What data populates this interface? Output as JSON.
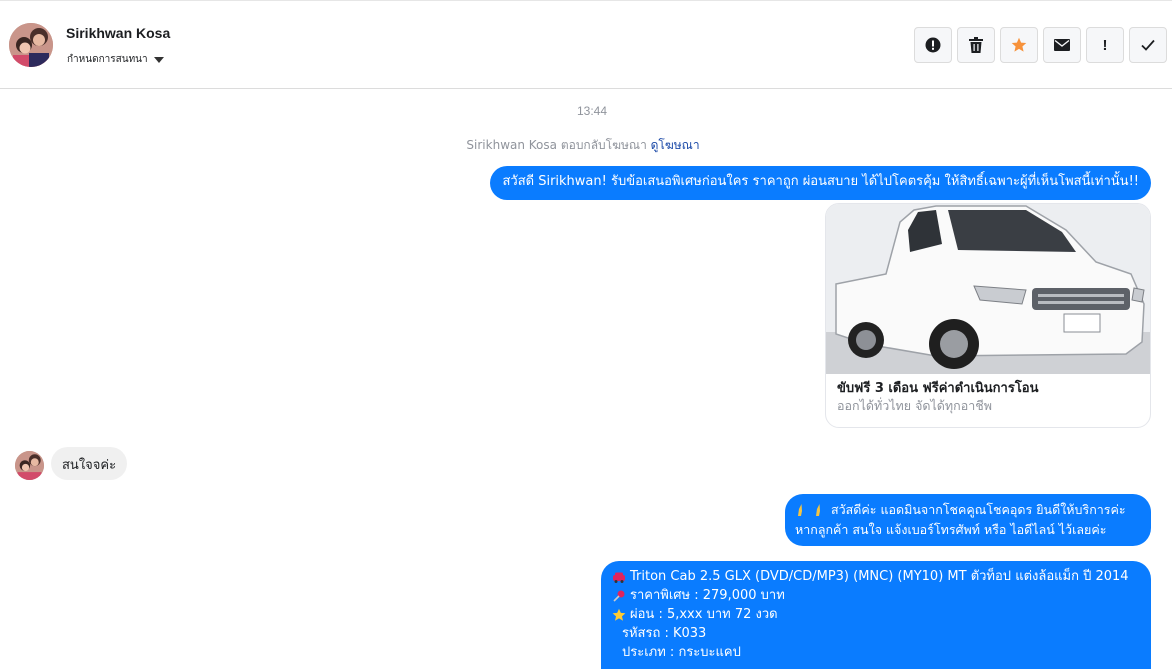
{
  "header": {
    "contact_name": "Sirikhwan Kosa",
    "conversation_menu": "กำหนดการสนทนา"
  },
  "toolbar": {
    "icons": [
      "alert-circle-icon",
      "trash-icon",
      "star-icon",
      "envelope-icon",
      "exclamation-icon",
      "check-icon"
    ],
    "exclamation_label": "!",
    "star_color": "#f7923b"
  },
  "thread": {
    "timestamp": "13:44",
    "reply_note_prefix": "Sirikhwan Kosa ตอบกลับโฆษณา ",
    "reply_note_link": "ดูโฆษณา",
    "accent": "#0a7cff"
  },
  "messages": {
    "outgoing_1": "สวัสดี Sirikhwan! รับข้อเสนอพิเศษก่อนใคร ราคาถูก ผ่อนสบาย ได้ไปโคตรคุ้ม ให้สิทธิ์เฉพาะผู้ที่เห็นโพสนี้เท่านั้น!!",
    "ad_card": {
      "title": "ขับฟรี 3 เดือน ฟรีค่าดำเนินการโอน",
      "description": "ออกได้ทั่วไทย จัดได้ทุกอาชีพ"
    },
    "incoming_1": "สนใจจค่ะ",
    "outgoing_2": {
      "line1": "สวัสดีค่ะ แอดมินจากโชคคูณโชคอุดร ยินดีให้บริการค่ะ",
      "line2": "หากลูกค้า สนใจ แจ้งเบอร์โทรศัพท์ หรือ ไอดีไลน์  ไว้เลยค่ะ"
    },
    "outgoing_3": {
      "line1": "Triton Cab 2.5 GLX (DVD/CD/MP3) (MNC) (MY10) MT ตัวท็อป แต่งล้อแม็ก ปี 2014",
      "line2": "ราคาพิเศษ : 279,000 บาท",
      "line3": "ผ่อน : 5,xxx บาท 72 งวด",
      "line4": "รหัสรถ : K033",
      "line5": "ประเภท : กระบะแคป"
    }
  }
}
